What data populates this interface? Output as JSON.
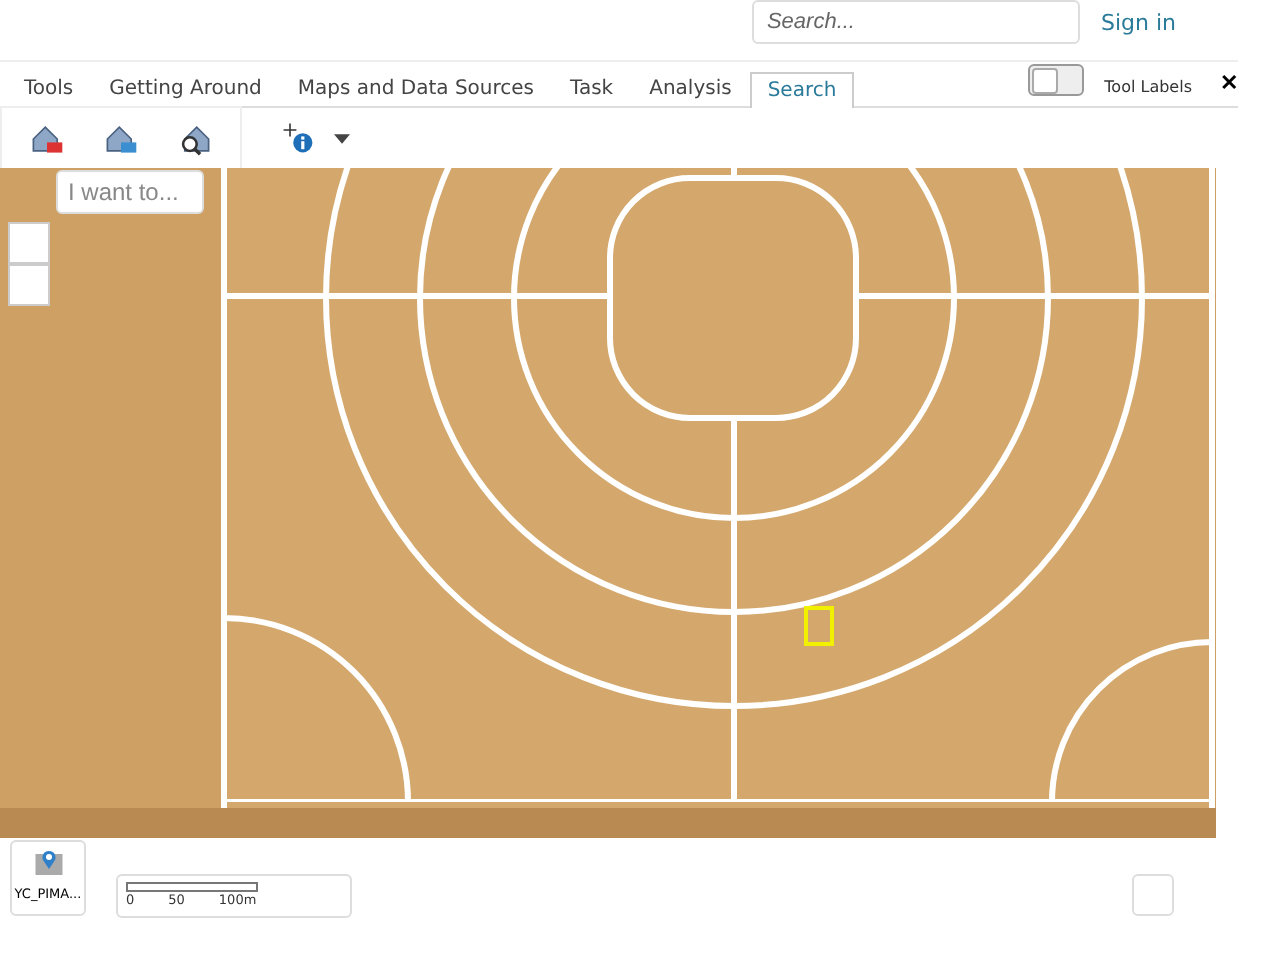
{
  "header": {
    "search": {
      "placeholder": "Search..."
    },
    "sign_in": "Sign in"
  },
  "tabs": [
    {
      "label": "Tools",
      "selected": false
    },
    {
      "label": "Getting Around",
      "selected": false
    },
    {
      "label": "Maps and Data Sources",
      "selected": false
    },
    {
      "label": "Task",
      "selected": false
    },
    {
      "label": "Analysis",
      "selected": false
    },
    {
      "label": "Search",
      "selected": true
    }
  ],
  "tool_labels": {
    "label": "Tool Labels",
    "on": false,
    "close": "✕"
  },
  "map": {
    "i_want_to": {
      "placeholder": "I want to..."
    },
    "basemap": {
      "label": "YC_PIMA..."
    },
    "scale": {
      "labels": [
        "0",
        "50",
        "100m"
      ]
    }
  }
}
